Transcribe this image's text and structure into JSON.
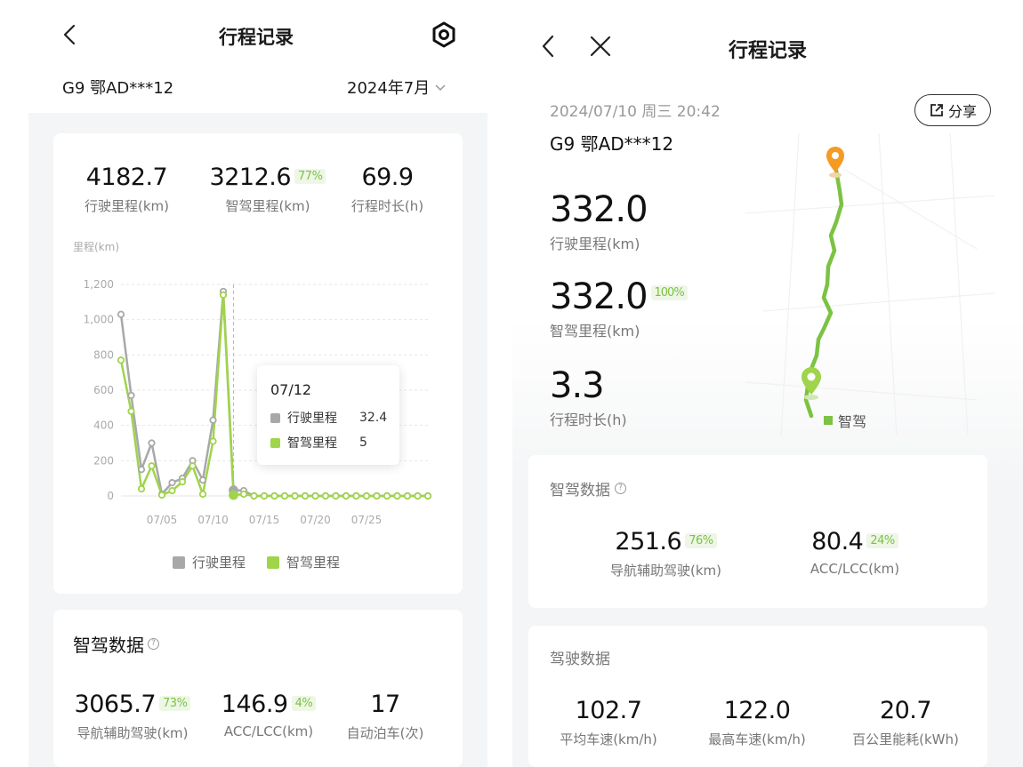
{
  "left": {
    "title": "行程记录",
    "vehicle": "G9 鄂AD***12",
    "month": "2024年7月",
    "stats": {
      "distance": {
        "value": "4182.7",
        "label": "行驶里程(km)"
      },
      "smart": {
        "value": "3212.6",
        "pct": "77%",
        "label": "智驾里程(km)"
      },
      "duration": {
        "value": "69.9",
        "label": "行程时长(h)"
      }
    },
    "chart_unit": "里程(km)",
    "tooltip": {
      "date": "07/12",
      "row1_label": "行驶里程",
      "row1_value": "32.4",
      "row2_label": "智驾里程",
      "row2_value": "5"
    },
    "legend": {
      "a": "行驶里程",
      "b": "智驾里程"
    },
    "smart_section": {
      "title": "智驾数据",
      "nav": {
        "value": "3065.7",
        "pct": "73%",
        "label": "导航辅助驾驶(km)"
      },
      "acc": {
        "value": "146.9",
        "pct": "4%",
        "label": "ACC/LCC(km)"
      },
      "park": {
        "value": "17",
        "label": "自动泊车(次)"
      }
    }
  },
  "right": {
    "title": "行程记录",
    "datetime": "2024/07/10 周三 20:42",
    "vehicle": "G9 鄂AD***12",
    "share": "分享",
    "distance": {
      "value": "332.0",
      "label": "行驶里程(km)"
    },
    "smart": {
      "value": "332.0",
      "pct": "100%",
      "label": "智驾里程(km)"
    },
    "duration": {
      "value": "3.3",
      "label": "行程时长(h)"
    },
    "map_legend": "智驾",
    "smart_section": {
      "title": "智驾数据",
      "nav": {
        "value": "251.6",
        "pct": "76%",
        "label": "导航辅助驾驶(km)"
      },
      "acc": {
        "value": "80.4",
        "pct": "24%",
        "label": "ACC/LCC(km)"
      }
    },
    "drive_section": {
      "title": "驾驶数据",
      "avg": {
        "value": "102.7",
        "label": "平均车速(km/h)"
      },
      "max": {
        "value": "122.0",
        "label": "最高车速(km/h)"
      },
      "energy": {
        "value": "20.7",
        "label": "百公里能耗(kWh)"
      }
    }
  },
  "colors": {
    "gray_series": "#a8a8a8",
    "green_series": "#9fd44b",
    "accent_green": "#7cc243",
    "orange_pin": "#f59a23"
  },
  "chart_data": {
    "type": "line",
    "title": "",
    "ylabel": "里程(km)",
    "ylim": [
      0,
      1200
    ],
    "yticks": [
      0,
      200,
      400,
      600,
      800,
      1000,
      1200
    ],
    "ytick_labels": [
      "0",
      "200",
      "400",
      "600",
      "800",
      "1,000",
      "1,200"
    ],
    "xtick_labels": [
      "07/05",
      "07/10",
      "07/15",
      "07/20",
      "07/25"
    ],
    "xtick_days": [
      5,
      10,
      15,
      20,
      25
    ],
    "x": [
      1,
      2,
      3,
      4,
      5,
      6,
      7,
      8,
      9,
      10,
      11,
      12,
      13,
      14,
      15,
      16,
      17,
      18,
      19,
      20,
      21,
      22,
      23,
      24,
      25,
      26,
      27,
      28,
      29,
      30,
      31
    ],
    "series": [
      {
        "name": "行驶里程",
        "values": [
          1030,
          570,
          150,
          300,
          10,
          75,
          100,
          200,
          90,
          430,
          1160,
          32.4,
          30,
          0,
          0,
          0,
          0,
          0,
          0,
          0,
          0,
          0,
          0,
          0,
          0,
          0,
          0,
          0,
          0,
          0,
          0
        ]
      },
      {
        "name": "智驾里程",
        "values": [
          770,
          480,
          40,
          170,
          5,
          30,
          80,
          170,
          10,
          310,
          1140,
          5,
          10,
          0,
          0,
          0,
          0,
          0,
          0,
          0,
          0,
          0,
          0,
          0,
          0,
          0,
          0,
          0,
          0,
          0,
          0
        ]
      }
    ],
    "highlight_day": 12,
    "grid": true,
    "legend": "bottom"
  }
}
